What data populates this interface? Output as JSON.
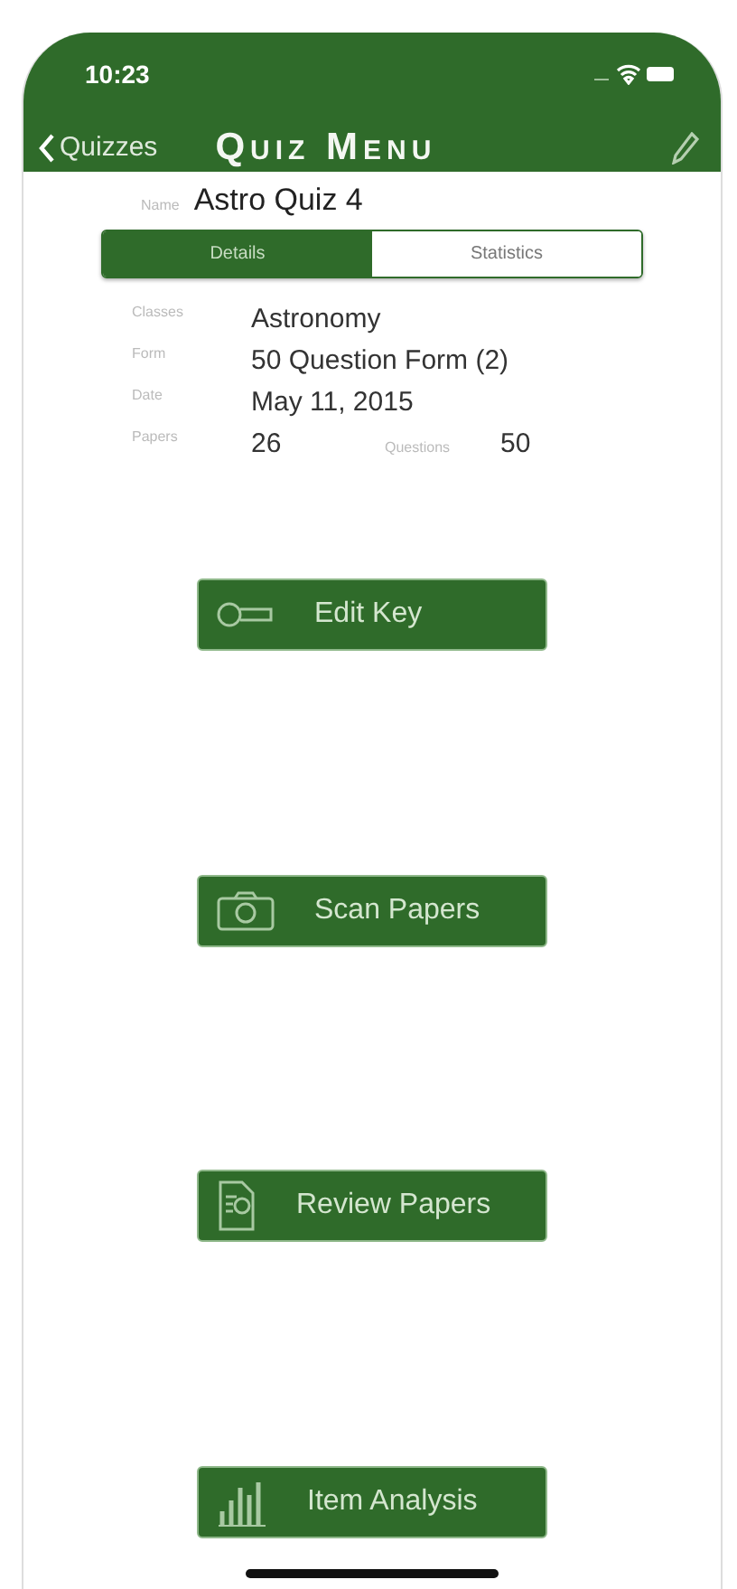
{
  "status_bar": {
    "time": "10:23"
  },
  "nav": {
    "back": "Quizzes",
    "title": "Quiz Menu"
  },
  "name": {
    "label": "Name",
    "value": "Astro Quiz 4"
  },
  "tabs": [
    {
      "label": "Details",
      "selected": true
    },
    {
      "label": "Statistics",
      "selected": false
    }
  ],
  "details": {
    "classes": {
      "label": "Classes",
      "value": "Astronomy"
    },
    "form": {
      "label": "Form",
      "value": "50 Question Form (2)"
    },
    "date": {
      "label": "Date",
      "value": "May 11, 2015"
    },
    "papers": {
      "label": "Papers",
      "value": "26"
    },
    "questions": {
      "label": "Questions",
      "value": "50"
    }
  },
  "actions": [
    {
      "label": "Edit Key",
      "kind": "key"
    },
    {
      "label": "Scan Papers",
      "kind": "camera"
    },
    {
      "label": "Review Papers",
      "kind": "document"
    },
    {
      "label": "Item Analysis",
      "kind": "chart"
    }
  ]
}
